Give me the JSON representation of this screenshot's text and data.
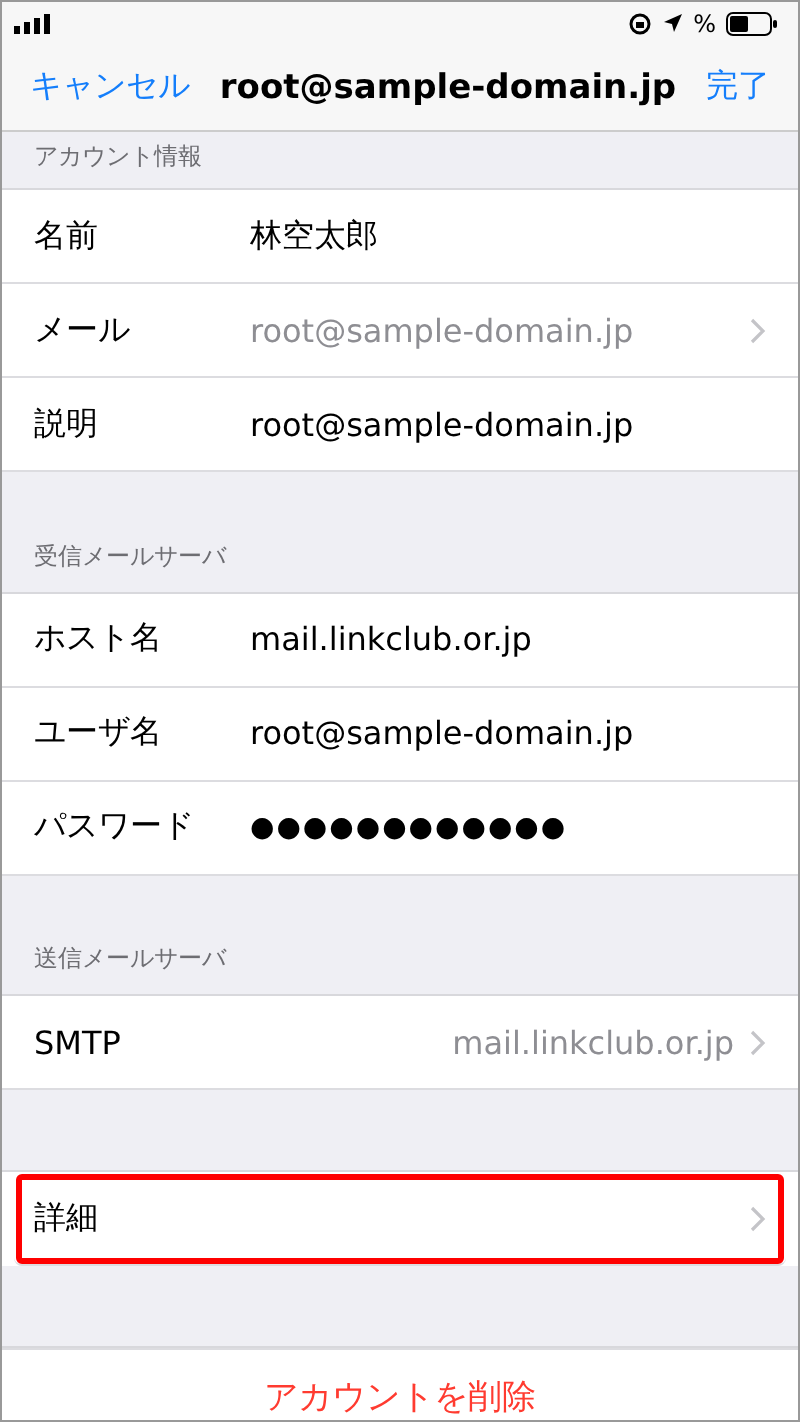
{
  "status_bar": {
    "battery_suffix": "%"
  },
  "nav": {
    "cancel": "キャンセル",
    "title": "root@sample-domain.jp",
    "done": "完了"
  },
  "sections": [
    {
      "header": "アカウント情報",
      "rows": [
        {
          "label": "名前",
          "value": "林空太郎",
          "kind": "text",
          "muted": false,
          "chevron": false,
          "highlighted": false
        },
        {
          "label": "メール",
          "value": "root@sample-domain.jp",
          "kind": "text",
          "muted": true,
          "chevron": true,
          "highlighted": false
        },
        {
          "label": "説明",
          "value": "root@sample-domain.jp",
          "kind": "text",
          "muted": false,
          "chevron": false,
          "highlighted": false
        }
      ]
    },
    {
      "header": "受信メールサーバ",
      "rows": [
        {
          "label": "ホスト名",
          "value": "mail.linkclub.or.jp",
          "kind": "text",
          "muted": false,
          "chevron": false,
          "highlighted": false
        },
        {
          "label": "ユーザ名",
          "value": "root@sample-domain.jp",
          "kind": "text",
          "muted": false,
          "chevron": false,
          "highlighted": false
        },
        {
          "label": "パスワード",
          "value": "●●●●●●●●●●●●",
          "kind": "password",
          "muted": false,
          "chevron": false,
          "highlighted": false
        }
      ]
    },
    {
      "header": "送信メールサーバ",
      "rows": [
        {
          "label": "SMTP",
          "value": "mail.linkclub.or.jp",
          "kind": "right",
          "muted": true,
          "chevron": true,
          "highlighted": false
        }
      ]
    },
    {
      "rows": [
        {
          "label": "詳細",
          "chevron": true,
          "highlighted": true
        }
      ]
    }
  ],
  "delete_button": "アカウントを削除"
}
